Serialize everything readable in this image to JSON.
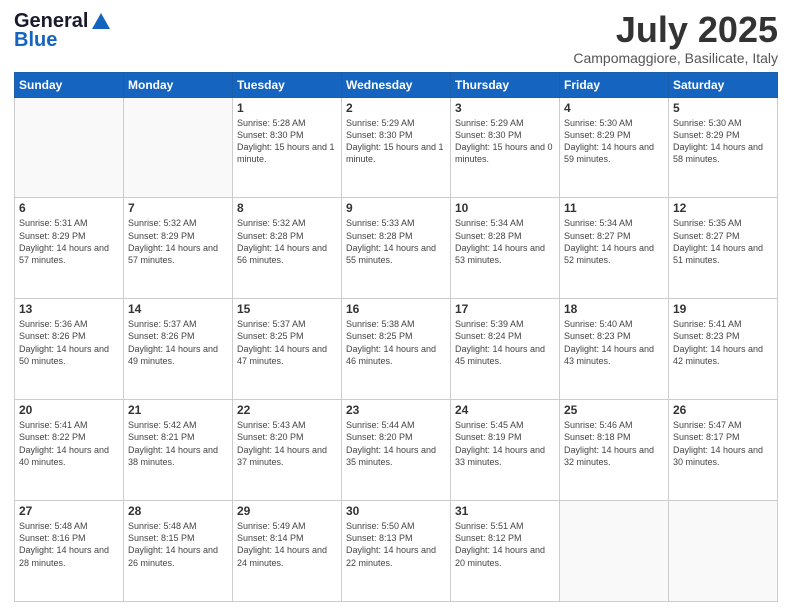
{
  "header": {
    "logo_line1": "General",
    "logo_line2": "Blue",
    "title": "July 2025",
    "location": "Campomaggiore, Basilicate, Italy"
  },
  "weekdays": [
    "Sunday",
    "Monday",
    "Tuesday",
    "Wednesday",
    "Thursday",
    "Friday",
    "Saturday"
  ],
  "weeks": [
    [
      {
        "day": "",
        "info": ""
      },
      {
        "day": "",
        "info": ""
      },
      {
        "day": "1",
        "info": "Sunrise: 5:28 AM\nSunset: 8:30 PM\nDaylight: 15 hours\nand 1 minute."
      },
      {
        "day": "2",
        "info": "Sunrise: 5:29 AM\nSunset: 8:30 PM\nDaylight: 15 hours\nand 1 minute."
      },
      {
        "day": "3",
        "info": "Sunrise: 5:29 AM\nSunset: 8:30 PM\nDaylight: 15 hours\nand 0 minutes."
      },
      {
        "day": "4",
        "info": "Sunrise: 5:30 AM\nSunset: 8:29 PM\nDaylight: 14 hours\nand 59 minutes."
      },
      {
        "day": "5",
        "info": "Sunrise: 5:30 AM\nSunset: 8:29 PM\nDaylight: 14 hours\nand 58 minutes."
      }
    ],
    [
      {
        "day": "6",
        "info": "Sunrise: 5:31 AM\nSunset: 8:29 PM\nDaylight: 14 hours\nand 57 minutes."
      },
      {
        "day": "7",
        "info": "Sunrise: 5:32 AM\nSunset: 8:29 PM\nDaylight: 14 hours\nand 57 minutes."
      },
      {
        "day": "8",
        "info": "Sunrise: 5:32 AM\nSunset: 8:28 PM\nDaylight: 14 hours\nand 56 minutes."
      },
      {
        "day": "9",
        "info": "Sunrise: 5:33 AM\nSunset: 8:28 PM\nDaylight: 14 hours\nand 55 minutes."
      },
      {
        "day": "10",
        "info": "Sunrise: 5:34 AM\nSunset: 8:28 PM\nDaylight: 14 hours\nand 53 minutes."
      },
      {
        "day": "11",
        "info": "Sunrise: 5:34 AM\nSunset: 8:27 PM\nDaylight: 14 hours\nand 52 minutes."
      },
      {
        "day": "12",
        "info": "Sunrise: 5:35 AM\nSunset: 8:27 PM\nDaylight: 14 hours\nand 51 minutes."
      }
    ],
    [
      {
        "day": "13",
        "info": "Sunrise: 5:36 AM\nSunset: 8:26 PM\nDaylight: 14 hours\nand 50 minutes."
      },
      {
        "day": "14",
        "info": "Sunrise: 5:37 AM\nSunset: 8:26 PM\nDaylight: 14 hours\nand 49 minutes."
      },
      {
        "day": "15",
        "info": "Sunrise: 5:37 AM\nSunset: 8:25 PM\nDaylight: 14 hours\nand 47 minutes."
      },
      {
        "day": "16",
        "info": "Sunrise: 5:38 AM\nSunset: 8:25 PM\nDaylight: 14 hours\nand 46 minutes."
      },
      {
        "day": "17",
        "info": "Sunrise: 5:39 AM\nSunset: 8:24 PM\nDaylight: 14 hours\nand 45 minutes."
      },
      {
        "day": "18",
        "info": "Sunrise: 5:40 AM\nSunset: 8:23 PM\nDaylight: 14 hours\nand 43 minutes."
      },
      {
        "day": "19",
        "info": "Sunrise: 5:41 AM\nSunset: 8:23 PM\nDaylight: 14 hours\nand 42 minutes."
      }
    ],
    [
      {
        "day": "20",
        "info": "Sunrise: 5:41 AM\nSunset: 8:22 PM\nDaylight: 14 hours\nand 40 minutes."
      },
      {
        "day": "21",
        "info": "Sunrise: 5:42 AM\nSunset: 8:21 PM\nDaylight: 14 hours\nand 38 minutes."
      },
      {
        "day": "22",
        "info": "Sunrise: 5:43 AM\nSunset: 8:20 PM\nDaylight: 14 hours\nand 37 minutes."
      },
      {
        "day": "23",
        "info": "Sunrise: 5:44 AM\nSunset: 8:20 PM\nDaylight: 14 hours\nand 35 minutes."
      },
      {
        "day": "24",
        "info": "Sunrise: 5:45 AM\nSunset: 8:19 PM\nDaylight: 14 hours\nand 33 minutes."
      },
      {
        "day": "25",
        "info": "Sunrise: 5:46 AM\nSunset: 8:18 PM\nDaylight: 14 hours\nand 32 minutes."
      },
      {
        "day": "26",
        "info": "Sunrise: 5:47 AM\nSunset: 8:17 PM\nDaylight: 14 hours\nand 30 minutes."
      }
    ],
    [
      {
        "day": "27",
        "info": "Sunrise: 5:48 AM\nSunset: 8:16 PM\nDaylight: 14 hours\nand 28 minutes."
      },
      {
        "day": "28",
        "info": "Sunrise: 5:48 AM\nSunset: 8:15 PM\nDaylight: 14 hours\nand 26 minutes."
      },
      {
        "day": "29",
        "info": "Sunrise: 5:49 AM\nSunset: 8:14 PM\nDaylight: 14 hours\nand 24 minutes."
      },
      {
        "day": "30",
        "info": "Sunrise: 5:50 AM\nSunset: 8:13 PM\nDaylight: 14 hours\nand 22 minutes."
      },
      {
        "day": "31",
        "info": "Sunrise: 5:51 AM\nSunset: 8:12 PM\nDaylight: 14 hours\nand 20 minutes."
      },
      {
        "day": "",
        "info": ""
      },
      {
        "day": "",
        "info": ""
      }
    ]
  ]
}
